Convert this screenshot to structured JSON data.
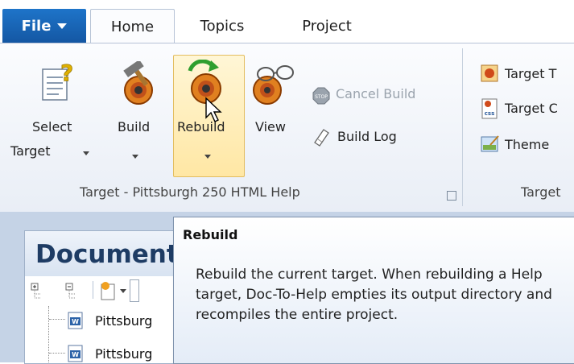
{
  "tabs": {
    "file": "File",
    "home": "Home",
    "topics": "Topics",
    "project": "Project"
  },
  "ribbon": {
    "select_target": [
      "Select",
      "Target"
    ],
    "build": "Build",
    "rebuild": "Rebuild",
    "view": "View",
    "cancel_build": "Cancel Build",
    "build_log": "Build Log",
    "group_label": "Target - Pittsburgh 250 HTML Help",
    "target_items": [
      "Target T",
      "Target C",
      "Theme"
    ],
    "target_group_label": "Target"
  },
  "panel": {
    "title": "Document",
    "items": [
      "Pittsburg",
      "Pittsburg"
    ]
  },
  "tooltip": {
    "title": "Rebuild",
    "body": "Rebuild the current target. When rebuilding a Help target, Doc-To-Help empties its output directory and recompiles the entire project."
  },
  "colors": {
    "file_button": "#1e74c9",
    "ribbon_bg": "#f3f6fb",
    "lower_bg": "#c5d3e6",
    "highlight": "#ffe7a4"
  }
}
